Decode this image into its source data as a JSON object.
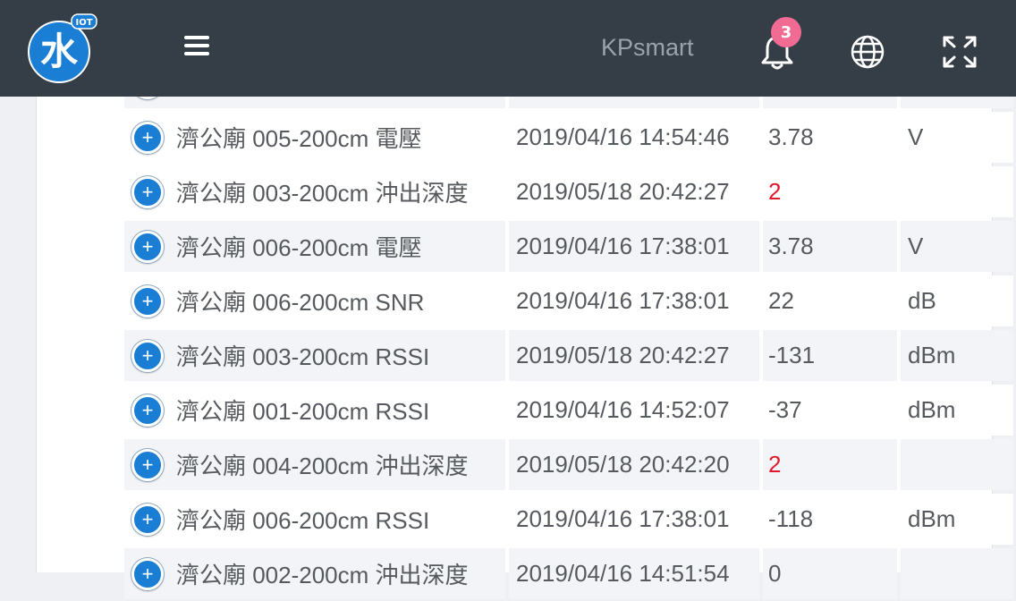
{
  "header": {
    "brand": "KPsmart",
    "notification_count": "3",
    "logo_glyph": "水",
    "logo_tag": "IOT",
    "colors": {
      "bar": "#353e47",
      "badge": "#f26b92",
      "logo": "#1a7fd4"
    }
  },
  "rows": [
    {
      "name": "濟公廟 005-200cm 電壓",
      "time": "2019/04/16 14:54:46",
      "value": "3.78",
      "unit": "V",
      "alert": false
    },
    {
      "name": "濟公廟 003-200cm 沖出深度",
      "time": "2019/05/18 20:42:27",
      "value": "2",
      "unit": "",
      "alert": true
    },
    {
      "name": "濟公廟 006-200cm 電壓",
      "time": "2019/04/16 17:38:01",
      "value": "3.78",
      "unit": "V",
      "alert": false
    },
    {
      "name": "濟公廟 006-200cm SNR",
      "time": "2019/04/16 17:38:01",
      "value": "22",
      "unit": "dB",
      "alert": false
    },
    {
      "name": "濟公廟 003-200cm RSSI",
      "time": "2019/05/18 20:42:27",
      "value": "-131",
      "unit": "dBm",
      "alert": false
    },
    {
      "name": "濟公廟 001-200cm RSSI",
      "time": "2019/04/16 14:52:07",
      "value": "-37",
      "unit": "dBm",
      "alert": false
    },
    {
      "name": "濟公廟 004-200cm 沖出深度",
      "time": "2019/05/18 20:42:20",
      "value": "2",
      "unit": "",
      "alert": true
    },
    {
      "name": "濟公廟 006-200cm RSSI",
      "time": "2019/04/16 17:38:01",
      "value": "-118",
      "unit": "dBm",
      "alert": false
    },
    {
      "name": "濟公廟 002-200cm 沖出深度",
      "time": "2019/04/16 14:51:54",
      "value": "0",
      "unit": "",
      "alert": false
    }
  ]
}
